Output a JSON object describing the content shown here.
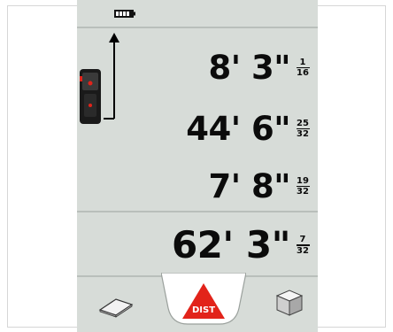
{
  "status": {
    "battery_icon": "battery-full-icon"
  },
  "readouts": [
    {
      "main": "8' 3\"",
      "num": "1",
      "den": "16"
    },
    {
      "main": "44' 6\"",
      "num": "25",
      "den": "32"
    },
    {
      "main": "7' 8\"",
      "num": "19",
      "den": "32"
    }
  ],
  "total": {
    "main": "62' 3\"",
    "num": "7",
    "den": "32"
  },
  "bottom": {
    "left_icon": "area-icon",
    "center_label": "DIST",
    "center_icon": "distance-triangle-icon",
    "right_icon": "volume-icon"
  },
  "colors": {
    "screen": "#d7dcd8",
    "accent_red": "#e2231a",
    "text": "#0b0b0b"
  }
}
